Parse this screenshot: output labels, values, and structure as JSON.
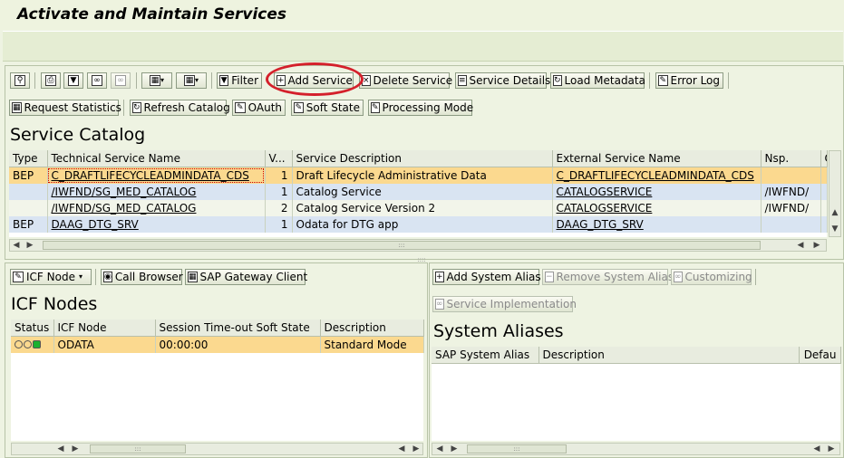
{
  "window": {
    "title": "Activate and Maintain Services"
  },
  "toolbar1": {
    "filter": "Filter",
    "add_service": "Add Service",
    "delete_service": "Delete Service",
    "service_details": "Service Details",
    "load_metadata": "Load Metadata",
    "error_log": "Error Log"
  },
  "toolbar2": {
    "request_statistics": "Request Statistics",
    "refresh_catalog": "Refresh Catalog",
    "oauth": "OAuth",
    "soft_state": "Soft State",
    "processing_mode": "Processing Mode"
  },
  "service_catalog": {
    "title": "Service Catalog",
    "columns": [
      "Type",
      "Technical Service Name",
      "V...",
      "Service Description",
      "External Service Name",
      "Nsp.",
      "O"
    ],
    "rows": [
      {
        "type": "BEP",
        "technical_name": "C_DRAFTLIFECYCLEADMINDATA_CDS",
        "version": "1",
        "description": "Draft Lifecycle Administrative Data",
        "external_name": "C_DRAFTLIFECYCLEADMINDATA_CDS",
        "nsp": ""
      },
      {
        "type": "",
        "technical_name": "/IWFND/SG_MED_CATALOG",
        "version": "1",
        "description": "Catalog Service",
        "external_name": "CATALOGSERVICE",
        "nsp": "/IWFND/"
      },
      {
        "type": "",
        "technical_name": "/IWFND/SG_MED_CATALOG",
        "version": "2",
        "description": "Catalog Service Version 2",
        "external_name": "CATALOGSERVICE",
        "nsp": "/IWFND/"
      },
      {
        "type": "BEP",
        "technical_name": "DAAG_DTG_SRV",
        "version": "1",
        "description": "Odata for DTG app",
        "external_name": "DAAG_DTG_SRV",
        "nsp": ""
      }
    ]
  },
  "icf_panel": {
    "icf_node_button": "ICF Node",
    "call_browser": "Call Browser",
    "gateway_client": "SAP Gateway Client",
    "title": "ICF Nodes",
    "columns": [
      "Status",
      "ICF Node",
      "Session Time-out Soft State",
      "Description"
    ],
    "rows": [
      {
        "icf_node": "ODATA",
        "timeout": "00:00:00",
        "description": "Standard Mode"
      }
    ]
  },
  "alias_panel": {
    "add_system_alias": "Add System Alias",
    "remove_system_alias": "Remove System Alias",
    "customizing": "Customizing",
    "service_implementation": "Service Implementation",
    "title": "System Aliases",
    "columns": [
      "SAP System Alias",
      "Description",
      "Defau"
    ]
  },
  "colors": {
    "highlight_ring": "#d4202b",
    "selected_row": "#fbd98f",
    "alt_row": "#d9e4f2"
  }
}
